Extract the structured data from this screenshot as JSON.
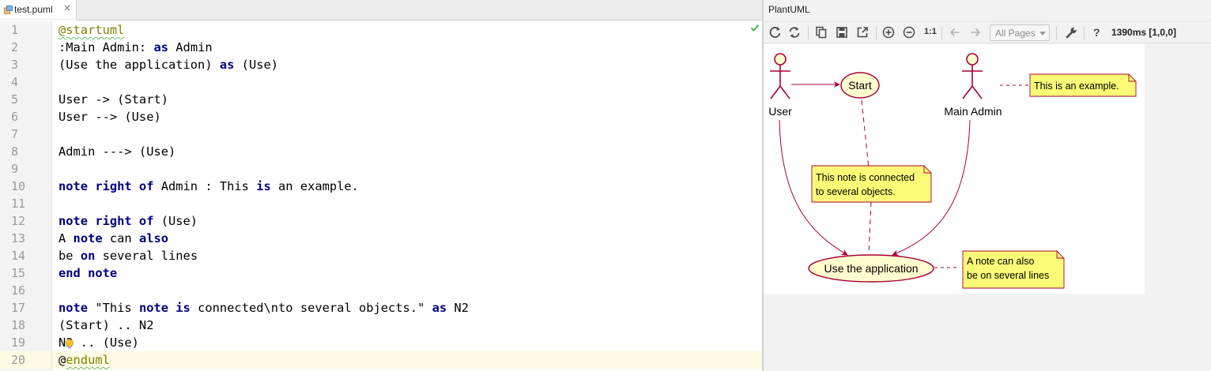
{
  "editor": {
    "tab_label": "test.puml",
    "current_line": 20,
    "lines": [
      {
        "n": "1",
        "html": "<span class=\"dir sq\">@startuml</span>"
      },
      {
        "n": "2",
        "html": ":Main Admin: <span class=\"kw\">as</span> Admin"
      },
      {
        "n": "3",
        "html": "(Use the application) <span class=\"kw\">as</span> (Use)"
      },
      {
        "n": "4",
        "html": ""
      },
      {
        "n": "5",
        "html": "User -> (Start)"
      },
      {
        "n": "6",
        "html": "User --> (Use)"
      },
      {
        "n": "7",
        "html": ""
      },
      {
        "n": "8",
        "html": "Admin ---> (Use)"
      },
      {
        "n": "9",
        "html": ""
      },
      {
        "n": "10",
        "html": "<span class=\"kw\">note right of</span> Admin : This <span class=\"kw\">is</span> an example."
      },
      {
        "n": "11",
        "html": ""
      },
      {
        "n": "12",
        "html": "<span class=\"kw\">note right of</span> (Use)"
      },
      {
        "n": "13",
        "html": "A <span class=\"kw\">note</span> can <span class=\"kw\">also</span>"
      },
      {
        "n": "14",
        "html": "be <span class=\"kw\">on</span> several lines"
      },
      {
        "n": "15",
        "html": "<span class=\"kw\">end note</span>"
      },
      {
        "n": "16",
        "html": ""
      },
      {
        "n": "17",
        "html": "<span class=\"kw\">note</span> \"This <span class=\"kw\">note is</span> connected\\nto several objects.\" <span class=\"kw\">as</span> N2"
      },
      {
        "n": "18",
        "html": "(Start) .. N2"
      },
      {
        "n": "19",
        "html": "N2 .. (Use)"
      },
      {
        "n": "20",
        "html": "@<span class=\"dir sq\">enduml</span>"
      }
    ]
  },
  "panel": {
    "title": "PlantUML",
    "pages_select": "All Pages",
    "zoom_reset_label": "1:1",
    "timing": "1390ms [1,0,0]"
  },
  "diagram": {
    "actors": [
      {
        "label": "User"
      },
      {
        "label": "Main Admin"
      }
    ],
    "usecases": [
      {
        "label": "Start"
      },
      {
        "label": "Use the application"
      }
    ],
    "notes": [
      {
        "lines": [
          "This is an example."
        ]
      },
      {
        "lines": [
          "This note is connected",
          "to several objects."
        ]
      },
      {
        "lines": [
          "A note can also",
          "be on several lines"
        ]
      }
    ],
    "colors": {
      "actor_stroke": "#a80036",
      "actor_fill": "#fefece",
      "usecase_fill": "#fefece",
      "note_fill": "#fbfb77",
      "arrow": "#a80036"
    }
  }
}
